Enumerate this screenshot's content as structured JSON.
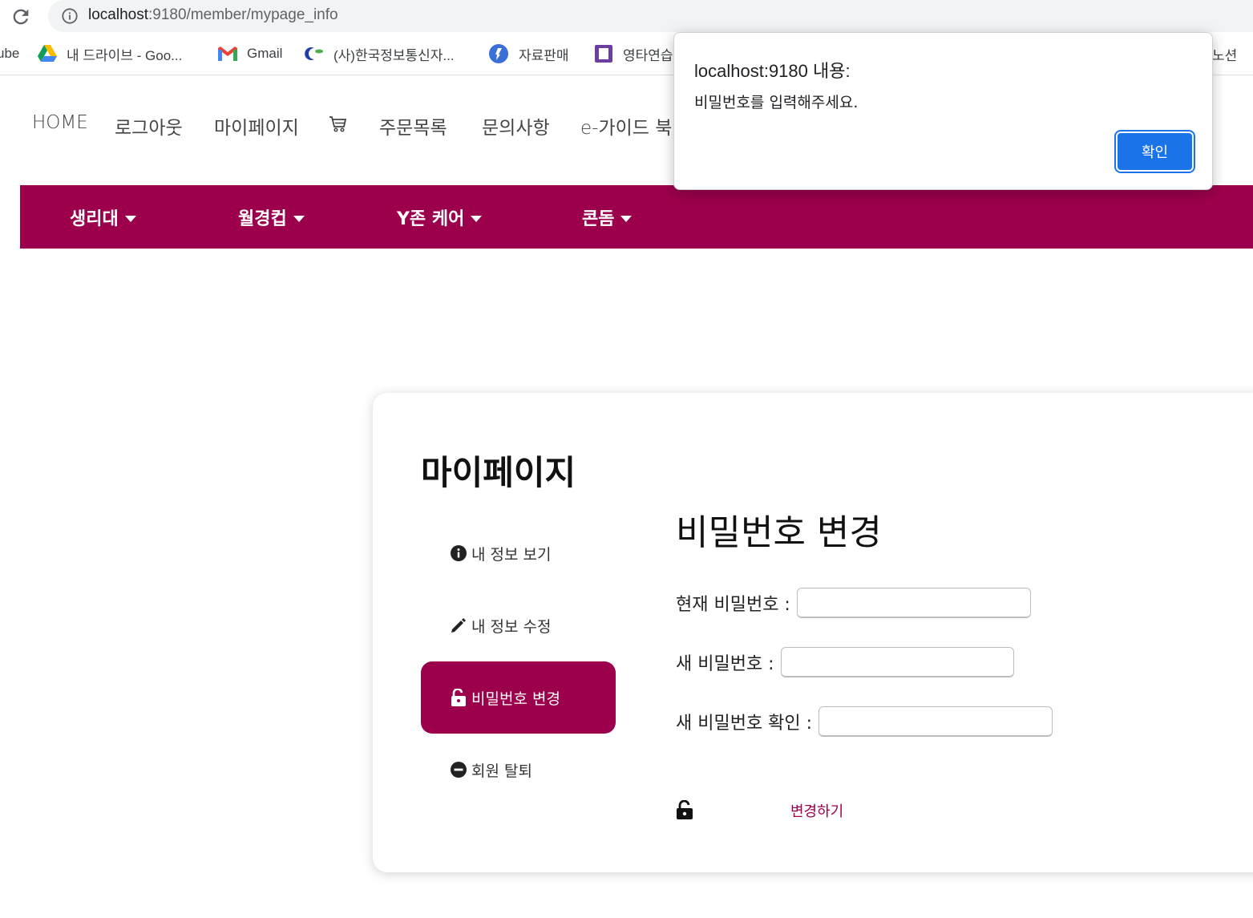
{
  "browser": {
    "url_host": "localhost",
    "url_path": ":9180/member/mypage_info",
    "bookmarks": [
      {
        "label": "ube",
        "icon": "youtube-icon"
      },
      {
        "label": "내 드라이브 - Goo...",
        "icon": "google-drive-icon"
      },
      {
        "label": "Gmail",
        "icon": "gmail-icon"
      },
      {
        "label": "(사)한국정보통신자...",
        "icon": "kait-icon"
      },
      {
        "label": "자료판매",
        "icon": "happycampus-icon"
      },
      {
        "label": "영타연습",
        "icon": "typing-icon"
      },
      {
        "label": "노션",
        "icon": "notion-icon"
      }
    ]
  },
  "topnav": {
    "items": [
      "HOME",
      "로그아웃",
      "마이페이지",
      "주문목록",
      "문의사항",
      "e-가이드 북"
    ],
    "cart_icon": "cart-icon"
  },
  "categories": [
    "생리대",
    "월경컵",
    "Y존 케어",
    "콘돔"
  ],
  "mypage": {
    "title": "마이페이지",
    "menu": [
      {
        "label": "내 정보 보기",
        "icon": "info-circle-icon"
      },
      {
        "label": "내 정보 수정",
        "icon": "pencil-icon"
      },
      {
        "label": "비밀번호 변경",
        "icon": "unlock-icon",
        "active": true
      },
      {
        "label": "회원 탈퇴",
        "icon": "minus-circle-icon"
      }
    ],
    "section_title": "비밀번호 변경",
    "form": {
      "current_label": "현재 비밀번호 :",
      "current_value": "",
      "new_label": "새 비밀번호 :",
      "new_value": "",
      "confirm_label": "새 비밀번호 확인 :",
      "confirm_value": ""
    },
    "submit_label": "변경하기"
  },
  "dialog": {
    "title": "localhost:9180 내용:",
    "message": "비밀번호를 입력해주세요.",
    "ok_label": "확인"
  },
  "colors": {
    "brand": "#9c004c",
    "dialog_button": "#1a73e8"
  }
}
